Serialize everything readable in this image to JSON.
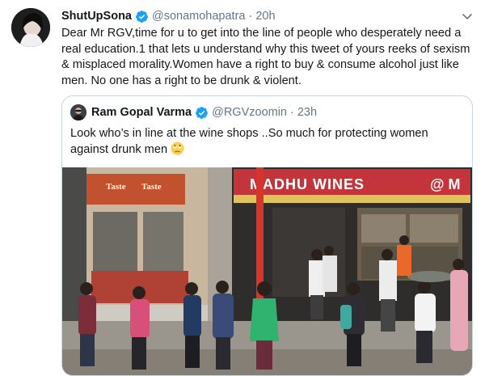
{
  "tweet": {
    "display_name": "ShutUpSona",
    "handle": "@sonamohapatra",
    "separator": "·",
    "time": "20h",
    "text": "Dear Mr RGV,time for u to get into the line of people who desperately need a real education.1 that lets u understand why this tweet of yours reeks of sexism & misplaced morality.Women have a right to buy & consume alcohol just like men. No one has a right to be drunk & violent."
  },
  "quoted": {
    "display_name": "Ram Gopal Varma",
    "handle": "@RGVzoomin",
    "separator": "·",
    "time": "23h",
    "text": "Look who’s in line at the wine shops ..So much for protecting women against drunk men"
  },
  "photo": {
    "sign_left_line1": "Taste",
    "sign_left_line2": "Taste",
    "sign_right": "MADHU WINES",
    "sign_right_prefix": "@",
    "sign_right_suffix": "@ M"
  },
  "colors": {
    "verified": "#1da1f2",
    "muted": "#657786",
    "border": "#ccd6dd"
  }
}
